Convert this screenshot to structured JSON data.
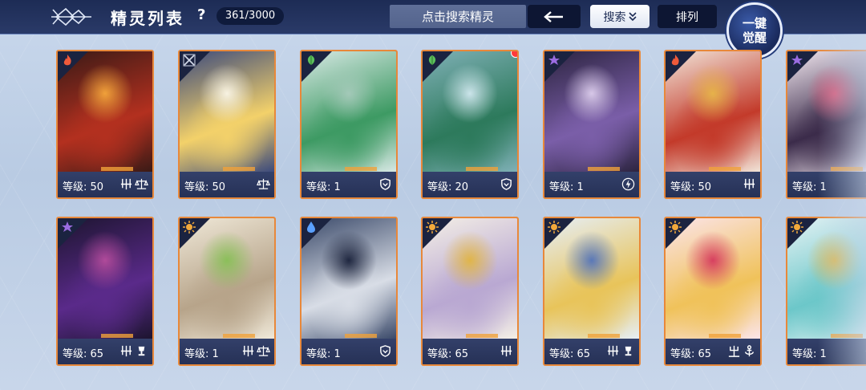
{
  "header": {
    "title": "精灵列表",
    "help_label": "?",
    "count": "361/3000",
    "search_placeholder": "点击搜索精灵",
    "search_label": "搜索",
    "sort_label": "排列",
    "awaken_line1": "一键",
    "awaken_line2": "觉醒"
  },
  "colors": {
    "card_border": "#e8883a",
    "header_bg": "#1d2c55",
    "fire": "#f05a3a",
    "grass": "#5cc05c",
    "light": "#f2a93b",
    "dark": "#9a6ce0",
    "water": "#5aa0ff",
    "fighter": "#cfd6e6"
  },
  "cards": [
    {
      "level": "等级: 50",
      "element": "fire-icon",
      "art": [
        "#3a1a16",
        "#b3301f",
        "#f0a13a"
      ],
      "skills": [
        "claw-icon",
        "scales-icon"
      ],
      "badge": false
    },
    {
      "level": "等级: 50",
      "element": "fighter-icon",
      "art": [
        "#3c4a7c",
        "#f3d16a",
        "#f7f2e2"
      ],
      "skills": [
        "scales-icon"
      ],
      "badge": false
    },
    {
      "level": "等级: 1",
      "element": "grass-icon",
      "art": [
        "#d7e8e4",
        "#3d9a63",
        "#a3c9b8"
      ],
      "skills": [
        "shield-icon"
      ],
      "badge": false
    },
    {
      "level": "等级: 20",
      "element": "grass-icon",
      "art": [
        "#7fb0b6",
        "#2d7a5c",
        "#cbe4ea"
      ],
      "skills": [
        "shield-icon"
      ],
      "badge": true
    },
    {
      "level": "等级: 1",
      "element": "dark-icon",
      "art": [
        "#2c2440",
        "#7a5ea8",
        "#d7c8e8"
      ],
      "skills": [
        "lightning-icon"
      ],
      "badge": false
    },
    {
      "level": "等级: 50",
      "element": "fire-icon",
      "art": [
        "#f1e4d8",
        "#c33a2a",
        "#e6b24a"
      ],
      "skills": [
        "claw-icon"
      ],
      "badge": false
    },
    {
      "level": "等级: 1",
      "element": "dark-icon",
      "art": [
        "#f2e8f0",
        "#3b2b4a",
        "#d45a7a"
      ],
      "skills": [
        "claw-icon"
      ],
      "badge": false
    },
    {
      "level": "等级: 65",
      "element": "dark-icon",
      "art": [
        "#1d1530",
        "#5a2a8a",
        "#b04a9a"
      ],
      "skills": [
        "claw-icon",
        "trophy-icon"
      ],
      "badge": false
    },
    {
      "level": "等级: 1",
      "element": "light-icon",
      "art": [
        "#efe8d8",
        "#b7a48a",
        "#8bbf5a"
      ],
      "skills": [
        "claw-icon",
        "scales-icon"
      ],
      "badge": false
    },
    {
      "level": "等级: 1",
      "element": "water-icon",
      "art": [
        "#3b4a6a",
        "#d8dde6",
        "#1f2740"
      ],
      "skills": [
        "shield-icon"
      ],
      "badge": false
    },
    {
      "level": "等级: 65",
      "element": "light-icon",
      "art": [
        "#f4efe6",
        "#b9a8d2",
        "#e0b54a"
      ],
      "skills": [
        "claw-icon"
      ],
      "badge": false
    },
    {
      "level": "等级: 65",
      "element": "light-icon",
      "art": [
        "#e6eef6",
        "#e8c45a",
        "#5a78b8"
      ],
      "skills": [
        "claw-icon",
        "trophy-icon"
      ],
      "badge": false
    },
    {
      "level": "等级: 65",
      "element": "light-icon",
      "art": [
        "#fbe4ea",
        "#f0c25a",
        "#d74060"
      ],
      "skills": [
        "trident-icon",
        "anchor-icon"
      ],
      "badge": false
    },
    {
      "level": "等级: 1",
      "element": "light-icon",
      "art": [
        "#e4f2f4",
        "#6cc7c9",
        "#d8b85a"
      ],
      "skills": [
        "claw-icon"
      ],
      "badge": false
    }
  ]
}
